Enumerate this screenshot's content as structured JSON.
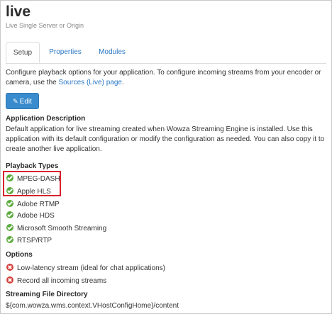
{
  "app": {
    "title": "live",
    "subtitle": "Live Single Server or Origin"
  },
  "tabs": [
    {
      "label": "Setup",
      "active": true
    },
    {
      "label": "Properties",
      "active": false
    },
    {
      "label": "Modules",
      "active": false
    }
  ],
  "intro": {
    "text": "Configure playback options for your application. To configure incoming streams from your encoder or camera, use the ",
    "link": "Sources (Live) page",
    "suffix": "."
  },
  "edit_button": {
    "label": "Edit",
    "icon": "pencil-icon"
  },
  "description": {
    "title": "Application Description",
    "text": "Default application for live streaming created when Wowza Streaming Engine is installed. Use this application with its default configuration or modify the configuration as needed. You can also copy it to create another live application."
  },
  "playback": {
    "title": "Playback Types",
    "items": [
      {
        "label": "MPEG-DASH",
        "enabled": true
      },
      {
        "label": "Apple HLS",
        "enabled": true
      },
      {
        "label": "Adobe RTMP",
        "enabled": true
      },
      {
        "label": "Adobe HDS",
        "enabled": true
      },
      {
        "label": "Microsoft Smooth Streaming",
        "enabled": true
      },
      {
        "label": "RTSP/RTP",
        "enabled": true
      }
    ]
  },
  "options": {
    "title": "Options",
    "items": [
      {
        "label": "Low-latency stream (ideal for chat applications)",
        "enabled": false
      },
      {
        "label": "Record all incoming streams",
        "enabled": false
      }
    ]
  },
  "streaming_dir": {
    "title": "Streaming File Directory",
    "value": "${com.wowza.wms.context.VHostConfigHome}/content"
  },
  "colors": {
    "link": "#2a77c4",
    "button": "#3a8bcd",
    "enabled": "#5aab3c",
    "disabled": "#d43f3a",
    "highlight": "#d9242f"
  }
}
